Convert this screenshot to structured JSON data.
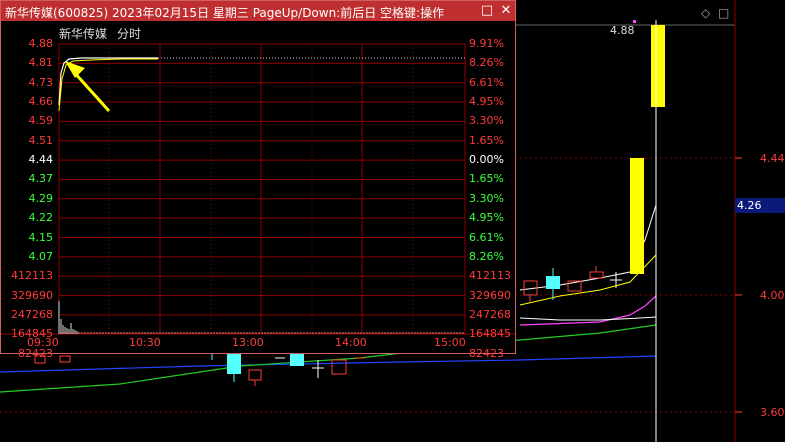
{
  "background_chart": {
    "price_labels": [
      "4.44",
      "4.00",
      "3.60"
    ],
    "current_price_marker": "4.26",
    "last_price_label": "4.88",
    "colors": {
      "up": "#ff3b3b",
      "down": "#54ffff",
      "limit": "#ffff00",
      "ma_white": "#ffffff",
      "ma_yellow": "#ffff00",
      "ma_magenta": "#ff44ff",
      "ma_green": "#22cc22",
      "ma_blue": "#2244ff"
    }
  },
  "popup": {
    "title": "新华传媒(600825) 2023年02月15日 星期三 PageUp/Down:前后日 空格键:操作",
    "restore_icon": "□",
    "close_icon": "✕",
    "stock_name": "新华传媒",
    "chart_mode": "分时",
    "price_labels_left": [
      "4.88",
      "4.81",
      "4.73",
      "4.66",
      "4.59",
      "4.51",
      "4.44",
      "4.37",
      "4.29",
      "4.22",
      "4.15",
      "4.07"
    ],
    "percent_labels_right": [
      "9.91%",
      "8.26%",
      "6.61%",
      "4.95%",
      "3.30%",
      "1.65%",
      "0.00%",
      "1.65%",
      "3.30%",
      "4.95%",
      "6.61%",
      "8.26%"
    ],
    "volume_labels": [
      "412113",
      "329690",
      "247268",
      "164845",
      "82423"
    ],
    "time_labels": [
      "09:30",
      "10:30",
      "13:00",
      "14:00",
      "15:00"
    ],
    "colors": {
      "up": "#ff3b3b",
      "flat": "#ffffff",
      "down": "#3bff3b",
      "grid": "#8b0000",
      "price_line": "#ffffff",
      "avg_line": "#ffff00",
      "arrow": "#ffff00"
    }
  }
}
